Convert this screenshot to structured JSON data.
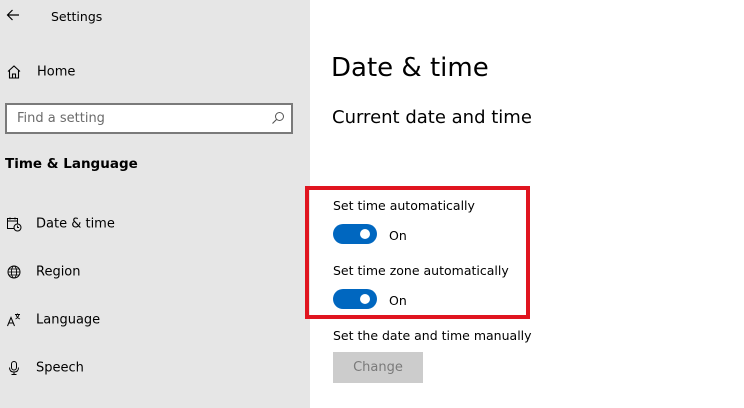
{
  "window": {
    "title": "Settings"
  },
  "sidebar": {
    "home_label": "Home",
    "search": {
      "placeholder": "Find a setting"
    },
    "section_heading": "Time & Language",
    "items": [
      {
        "label": "Date & time",
        "icon": "calendar-clock-icon"
      },
      {
        "label": "Region",
        "icon": "globe-icon"
      },
      {
        "label": "Language",
        "icon": "language-icon"
      },
      {
        "label": "Speech",
        "icon": "microphone-icon"
      }
    ]
  },
  "main": {
    "page_title": "Date & time",
    "subtitle": "Current date and time",
    "settings": [
      {
        "label": "Set time automatically",
        "state": "On"
      },
      {
        "label": "Set time zone automatically",
        "state": "On"
      }
    ],
    "manual": {
      "label": "Set the date and time manually",
      "button_label": "Change"
    }
  },
  "colors": {
    "accent": "#0067c0",
    "highlight": "#e0151f",
    "sidebar_bg": "#e6e6e6"
  }
}
